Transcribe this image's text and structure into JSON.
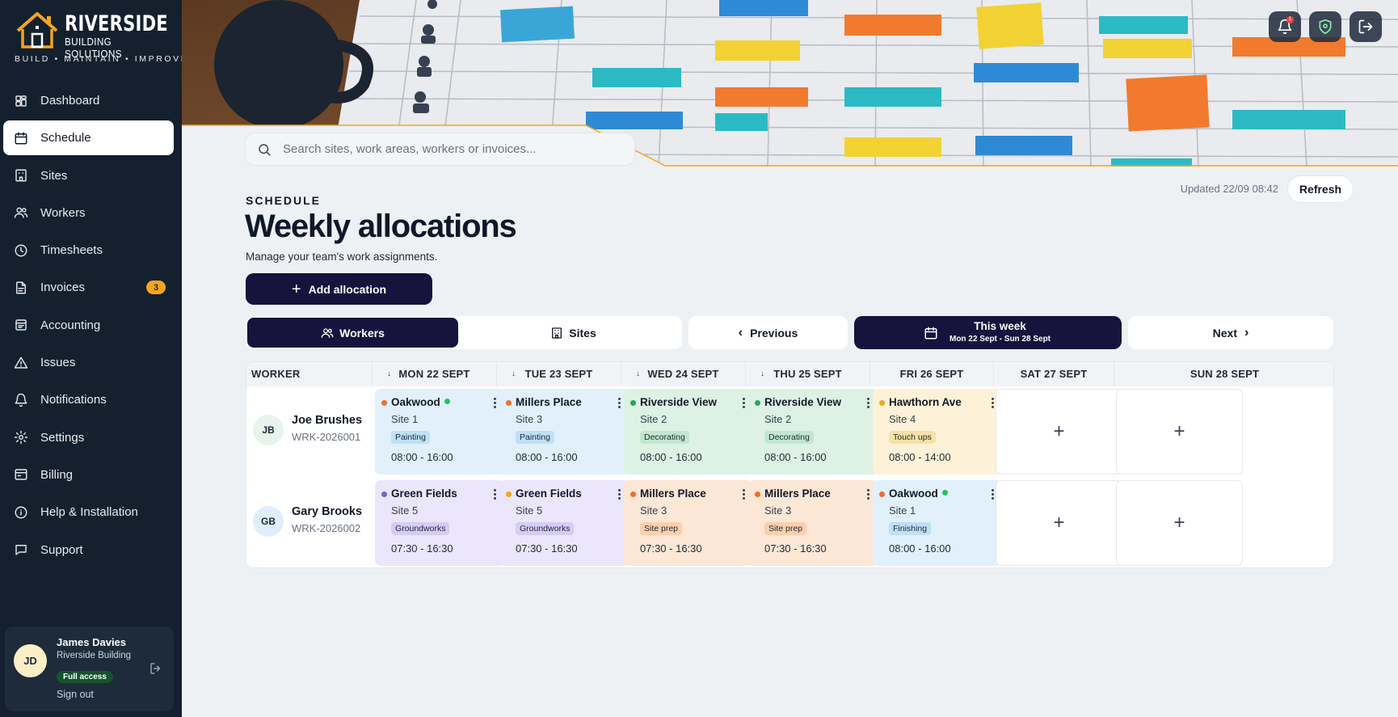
{
  "brand": {
    "name": "RIVERSIDE",
    "sub": "BUILDING SOLUTIONS",
    "tagline": "BUILD • MAINTAIN • IMPROVE",
    "accent": "#f4a51c"
  },
  "sidebar": {
    "items": [
      {
        "label": "Dashboard",
        "icon": "dashboard-icon"
      },
      {
        "label": "Schedule",
        "icon": "calendar-icon",
        "active": true
      },
      {
        "label": "Sites",
        "icon": "building-icon"
      },
      {
        "label": "Workers",
        "icon": "users-icon"
      },
      {
        "label": "Timesheets",
        "icon": "clock-icon"
      },
      {
        "label": "Invoices",
        "icon": "file-icon",
        "badge": "3"
      },
      {
        "label": "Accounting",
        "icon": "ledger-icon"
      },
      {
        "label": "Issues",
        "icon": "warning-icon"
      },
      {
        "label": "Notifications",
        "icon": "bell-icon"
      },
      {
        "label": "Settings",
        "icon": "gear-icon"
      },
      {
        "label": "Billing",
        "icon": "billing-icon"
      },
      {
        "label": "Help & Installation",
        "icon": "help-icon"
      },
      {
        "label": "Support",
        "icon": "chat-icon"
      }
    ]
  },
  "user": {
    "initials": "JD",
    "name": "James Davies",
    "org": "Riverside Building",
    "access": "Full access",
    "signout": "Sign out"
  },
  "header": {
    "notification_count": "1"
  },
  "search": {
    "placeholder": "Search sites, work areas, workers or invoices..."
  },
  "page": {
    "eyebrow": "SCHEDULE",
    "title": "Weekly allocations",
    "subtitle": "Manage your team's work assignments.",
    "updated": "Updated 22/09 08:42",
    "refresh": "Refresh",
    "add_label": "Add allocation"
  },
  "view_toggle": {
    "workers": "Workers",
    "sites": "Sites"
  },
  "week_nav": {
    "previous": "Previous",
    "current_label": "This week",
    "current_range": "Mon 22 Sept - Sun 28 Sept",
    "next": "Next"
  },
  "grid": {
    "worker_header": "WORKER",
    "days": [
      "MON 22 SEPT",
      "TUE 23 SEPT",
      "WED 24 SEPT",
      "THU 25 SEPT",
      "FRI 26 SEPT",
      "SAT 27 SEPT",
      "SUN 28 SEPT"
    ],
    "rows": [
      {
        "initials": "JB",
        "name": "Joe Brushes",
        "id": "WRK-2026001",
        "cells": [
          {
            "site": "Oakwood",
            "area": "Site 1",
            "tag": "Painting",
            "time": "08:00 - 16:00"
          },
          {
            "site": "Millers Place",
            "area": "Site 3",
            "tag": "Painting",
            "time": "08:00 - 16:00"
          },
          {
            "site": "Riverside View",
            "area": "Site 2",
            "tag": "Decorating",
            "time": "08:00 - 16:00"
          },
          {
            "site": "Riverside View",
            "area": "Site 2",
            "tag": "Decorating",
            "time": "08:00 - 16:00"
          },
          {
            "site": "Hawthorn Ave",
            "area": "Site 4",
            "tag": "Touch ups",
            "time": "08:00 - 14:00"
          }
        ]
      },
      {
        "initials": "GB",
        "name": "Gary Brooks",
        "id": "WRK-2026002",
        "cells": [
          {
            "site": "Green Fields",
            "area": "Site 5",
            "tag": "Groundworks",
            "time": "07:30 - 16:30"
          },
          {
            "site": "Green Fields",
            "area": "Site 5",
            "tag": "Groundworks",
            "time": "07:30 - 16:30"
          },
          {
            "site": "Millers Place",
            "area": "Site 3",
            "tag": "Site prep",
            "time": "07:30 - 16:30"
          },
          {
            "site": "Millers Place",
            "area": "Site 3",
            "tag": "Site prep",
            "time": "07:30 - 16:30"
          },
          {
            "site": "Oakwood",
            "area": "Site 1",
            "tag": "Finishing",
            "time": "08:00 - 16:00"
          }
        ]
      }
    ],
    "empty_symbol": "+"
  }
}
